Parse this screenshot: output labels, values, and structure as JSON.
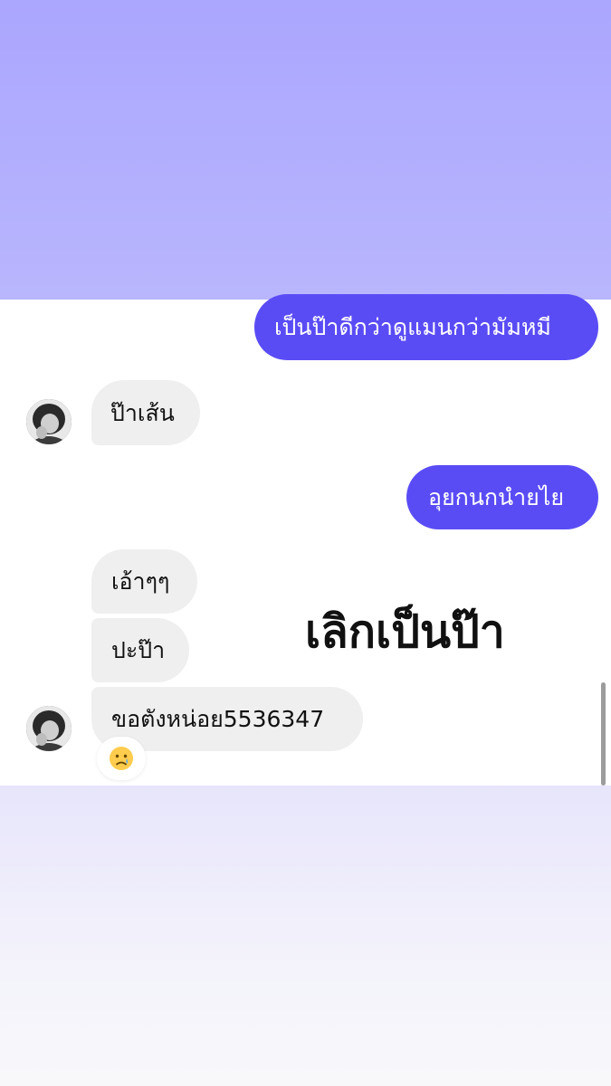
{
  "colors": {
    "top_band": "#aba6fe",
    "outgoing_bubble": "#5a4cf5",
    "incoming_bubble": "#efefef",
    "chat_background": "#ffffff",
    "bottom_band": "#f3f2fb"
  },
  "messages": {
    "out_1": "เป็นป๊าดีกว่าดูแมนกว่ามัมหมี",
    "in_1": "ป๊าเส้น",
    "out_2": "อุยกนกนำยไย",
    "in_2": "เอ้าๆๆ",
    "in_3": "ปะป๊า",
    "in_4": "ขอตังหน่อย5536347"
  },
  "overlay_caption": "เลิกเป็นป๊า",
  "reaction": {
    "icon": "crying-face-icon",
    "emoji": "😢"
  }
}
